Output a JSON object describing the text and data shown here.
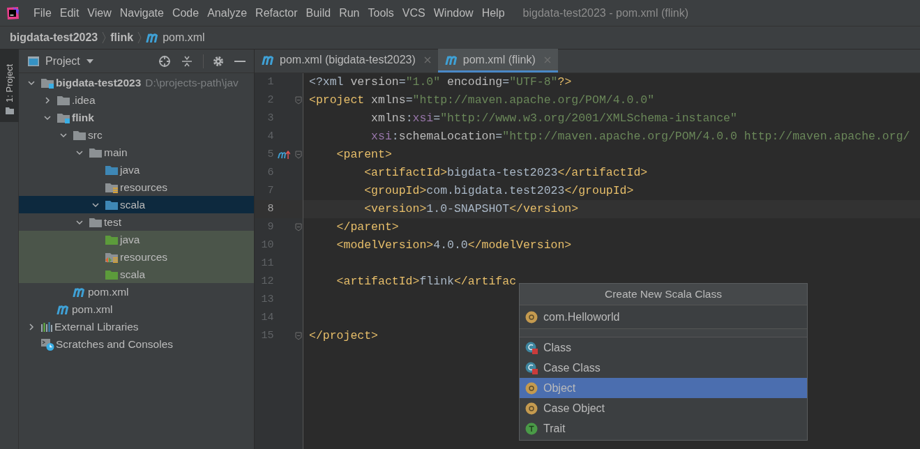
{
  "menu": [
    {
      "label": "File"
    },
    {
      "label": "Edit"
    },
    {
      "label": "View"
    },
    {
      "label": "Navigate"
    },
    {
      "label": "Code"
    },
    {
      "label": "Analyze"
    },
    {
      "label": "Refactor"
    },
    {
      "label": "Build"
    },
    {
      "label": "Run"
    },
    {
      "label": "Tools"
    },
    {
      "label": "VCS"
    },
    {
      "label": "Window"
    },
    {
      "label": "Help"
    }
  ],
  "window": {
    "title": "bigdata-test2023 - pom.xml (flink)"
  },
  "breadcrumbs": [
    {
      "label": "bigdata-test2023",
      "kind": "folder"
    },
    {
      "label": "flink",
      "kind": "folder"
    },
    {
      "label": "pom.xml",
      "kind": "maven"
    }
  ],
  "tool_stripe": {
    "label": "1: Project",
    "selected": true
  },
  "project_panel": {
    "title": "Project",
    "tree": [
      {
        "label": "bigdata-test2023",
        "hint": "D:\\projects-path\\jav",
        "kind": "module",
        "bold": true,
        "expanded": true,
        "selected": false,
        "children": [
          {
            "label": ".idea",
            "kind": "folder",
            "expanded": false,
            "selected": false
          },
          {
            "label": "flink",
            "kind": "module",
            "bold": true,
            "expanded": true,
            "selected": false,
            "children": [
              {
                "label": "src",
                "kind": "folder",
                "expanded": true,
                "selected": false,
                "children": [
                  {
                    "label": "main",
                    "kind": "folder",
                    "expanded": true,
                    "selected": false,
                    "children": [
                      {
                        "label": "java",
                        "kind": "source",
                        "selected": false
                      },
                      {
                        "label": "resources",
                        "kind": "resources",
                        "selected": false
                      },
                      {
                        "label": "scala",
                        "kind": "source",
                        "expanded": true,
                        "selected": true
                      }
                    ]
                  },
                  {
                    "label": "test",
                    "kind": "folder",
                    "expanded": true,
                    "selected": false,
                    "children": [
                      {
                        "label": "java",
                        "kind": "test-source",
                        "test": true,
                        "selected": false
                      },
                      {
                        "label": "resources",
                        "kind": "test-resources",
                        "test": true,
                        "selected": false
                      },
                      {
                        "label": "scala",
                        "kind": "test-source",
                        "test": true,
                        "selected": false
                      }
                    ]
                  }
                ]
              },
              {
                "label": "pom.xml",
                "kind": "maven",
                "selected": false
              }
            ]
          },
          {
            "label": "pom.xml",
            "kind": "maven",
            "selected": false
          }
        ]
      },
      {
        "label": "External Libraries",
        "kind": "libraries",
        "expanded": false,
        "selected": false
      },
      {
        "label": "Scratches and Consoles",
        "kind": "scratches",
        "selected": false
      }
    ]
  },
  "tabs": [
    {
      "label": "pom.xml (bigdata-test2023)",
      "selected": false
    },
    {
      "label": "pom.xml (flink)",
      "selected": true
    }
  ],
  "editor": {
    "lines": [
      {
        "number": "1",
        "current": false,
        "fold": false,
        "tokens": [
          {
            "kind": "text",
            "text": "<?xml"
          },
          {
            "kind": "attr",
            "text": " version"
          },
          {
            "kind": "text",
            "text": "="
          },
          {
            "kind": "value",
            "text": "\"1.0\""
          },
          {
            "kind": "attr",
            "text": " encoding"
          },
          {
            "kind": "text",
            "text": "="
          },
          {
            "kind": "value",
            "text": "\"UTF-8\""
          },
          {
            "kind": "tag",
            "text": "?>"
          }
        ]
      },
      {
        "number": "2",
        "current": false,
        "fold": true,
        "tokens": [
          {
            "kind": "tag",
            "text": "<project"
          },
          {
            "kind": "attr",
            "text": " xmlns"
          },
          {
            "kind": "text",
            "text": "="
          },
          {
            "kind": "value",
            "text": "\"http://maven.apache.org/POM/4.0.0\""
          }
        ]
      },
      {
        "number": "3",
        "current": false,
        "fold": false,
        "tokens": [
          {
            "kind": "attr",
            "text": "         xmlns"
          },
          {
            "kind": "text",
            "text": ":"
          },
          {
            "kind": "ns",
            "text": "xsi"
          },
          {
            "kind": "text",
            "text": "="
          },
          {
            "kind": "value",
            "text": "\"http://www.w3.org/2001/XMLSchema-instance\""
          }
        ]
      },
      {
        "number": "4",
        "current": false,
        "fold": false,
        "tokens": [
          {
            "kind": "ns",
            "text": "         xsi"
          },
          {
            "kind": "text",
            "text": ":"
          },
          {
            "kind": "attr",
            "text": "schemaLocation"
          },
          {
            "kind": "text",
            "text": "="
          },
          {
            "kind": "value",
            "text": "\"http://maven.apache.org/POM/4.0.0 http://maven.apache.org/"
          }
        ]
      },
      {
        "number": "5",
        "current": false,
        "fold": true,
        "parent_marker": true,
        "tokens": [
          {
            "kind": "tag",
            "text": "    <parent>"
          }
        ]
      },
      {
        "number": "6",
        "current": false,
        "fold": false,
        "tokens": [
          {
            "kind": "tag",
            "text": "        <artifactId>"
          },
          {
            "kind": "text",
            "text": "bigdata-test2023"
          },
          {
            "kind": "tag",
            "text": "</artifactId>"
          }
        ]
      },
      {
        "number": "7",
        "current": false,
        "fold": false,
        "tokens": [
          {
            "kind": "tag",
            "text": "        <groupId>"
          },
          {
            "kind": "text",
            "text": "com.bigdata.test2023"
          },
          {
            "kind": "tag",
            "text": "</groupId>"
          }
        ]
      },
      {
        "number": "8",
        "current": true,
        "fold": false,
        "tokens": [
          {
            "kind": "tag",
            "text": "        <version>"
          },
          {
            "kind": "text",
            "text": "1.0-SNAPSHOT"
          },
          {
            "kind": "tag",
            "text": "</version>"
          }
        ]
      },
      {
        "number": "9",
        "current": false,
        "fold": true,
        "tokens": [
          {
            "kind": "tag",
            "text": "    </parent>"
          }
        ]
      },
      {
        "number": "10",
        "current": false,
        "fold": false,
        "tokens": [
          {
            "kind": "tag",
            "text": "    <modelVersion>"
          },
          {
            "kind": "text",
            "text": "4.0.0"
          },
          {
            "kind": "tag",
            "text": "</modelVersion>"
          }
        ]
      },
      {
        "number": "11",
        "current": false,
        "fold": false
      },
      {
        "number": "12",
        "current": false,
        "fold": false,
        "tokens": [
          {
            "kind": "tag",
            "text": "    <artifactId>"
          },
          {
            "kind": "text",
            "text": "flink"
          },
          {
            "kind": "tag",
            "text": "</artifac"
          }
        ]
      },
      {
        "number": "13",
        "current": false,
        "fold": false
      },
      {
        "number": "14",
        "current": false,
        "fold": false
      },
      {
        "number": "15",
        "current": false,
        "fold": true,
        "tokens": [
          {
            "kind": "tag",
            "text": "</project>"
          }
        ]
      }
    ]
  },
  "dialog": {
    "title": "Create New Scala Class",
    "value": "com.Helloworld",
    "items": [
      {
        "label": "Class",
        "kind": "class",
        "selected": false
      },
      {
        "label": "Case Class",
        "kind": "class",
        "selected": false
      },
      {
        "label": "Object",
        "kind": "object",
        "selected": true
      },
      {
        "label": "Case Object",
        "kind": "object",
        "selected": false
      },
      {
        "label": "Trait",
        "kind": "trait",
        "selected": false
      }
    ]
  }
}
